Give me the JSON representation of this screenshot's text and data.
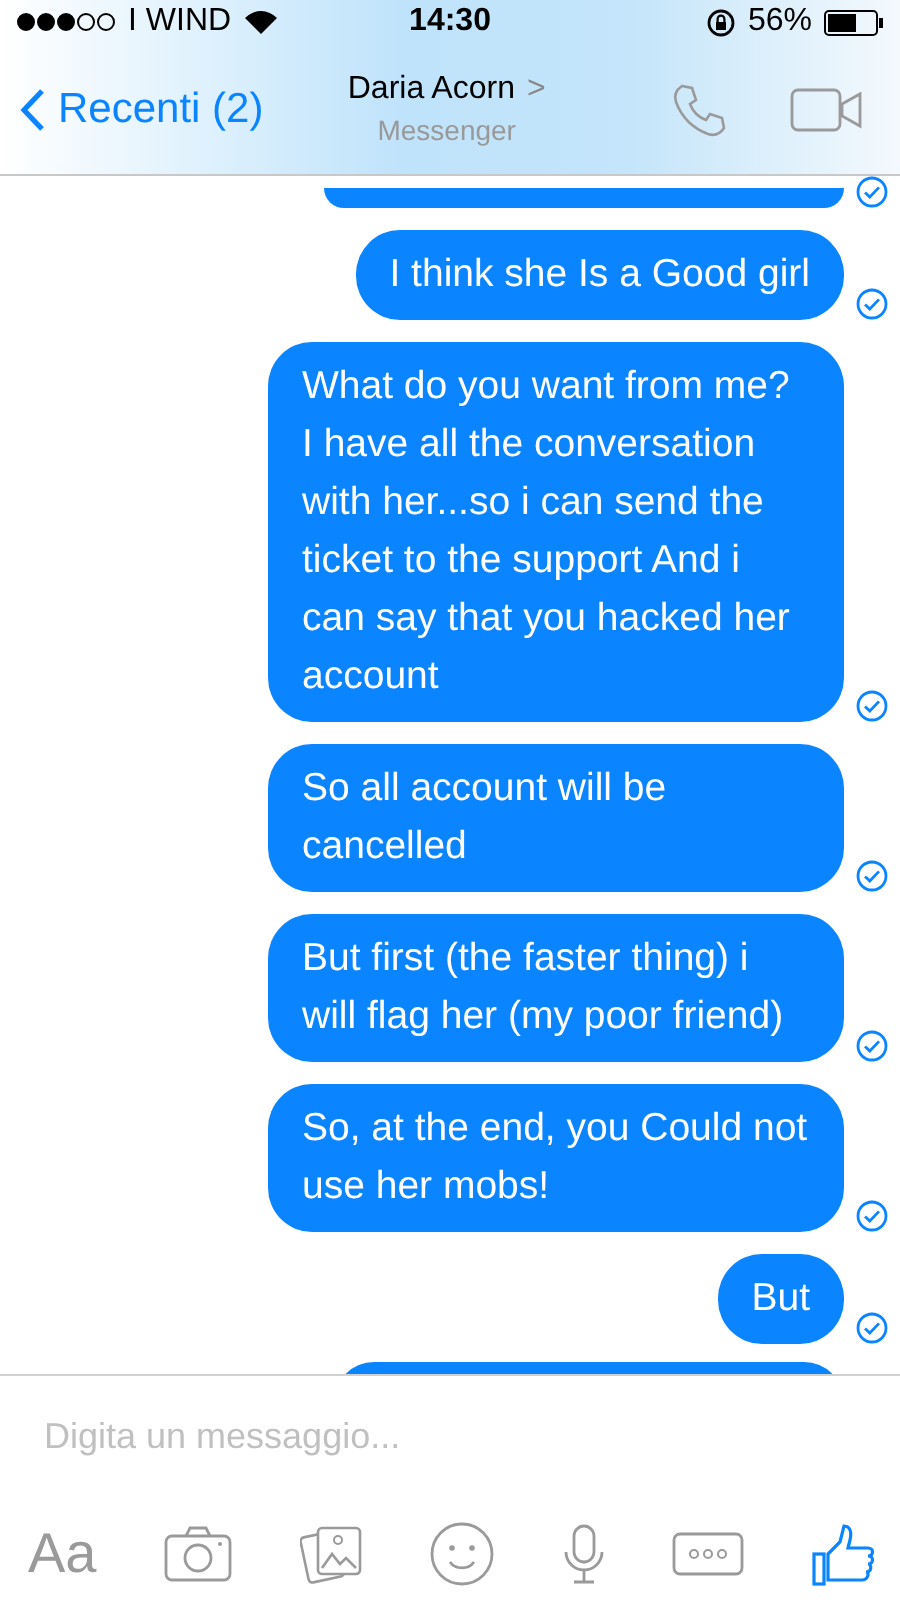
{
  "status_bar": {
    "carrier": "I WIND",
    "time": "14:30",
    "battery": "56%"
  },
  "header": {
    "back": "Recenti (2)",
    "title": "Daria Acorn",
    "subtitle": "Messenger",
    "chevron": ">"
  },
  "messages": [
    {
      "kind": "partial",
      "delivered": true
    },
    {
      "kind": "text",
      "text": "I think she Is a Good girl",
      "delivered": true
    },
    {
      "kind": "text",
      "text": "What do you want from me? I have all the conversation with her...so i can send the ticket to the support And i can say that you hacked her account",
      "delivered": true
    },
    {
      "kind": "text",
      "text": "So all account will be cancelled",
      "delivered": true
    },
    {
      "kind": "text",
      "text": "But first (the faster thing) i will flag her (my poor friend)",
      "delivered": true
    },
    {
      "kind": "text",
      "text": "So, at the end, you Could not use her mobs!",
      "delivered": true
    },
    {
      "kind": "text",
      "text": "But",
      "delivered": true
    },
    {
      "kind": "partial"
    }
  ],
  "composer": {
    "placeholder": "Digita un messaggio...",
    "text_button": "Aa"
  }
}
